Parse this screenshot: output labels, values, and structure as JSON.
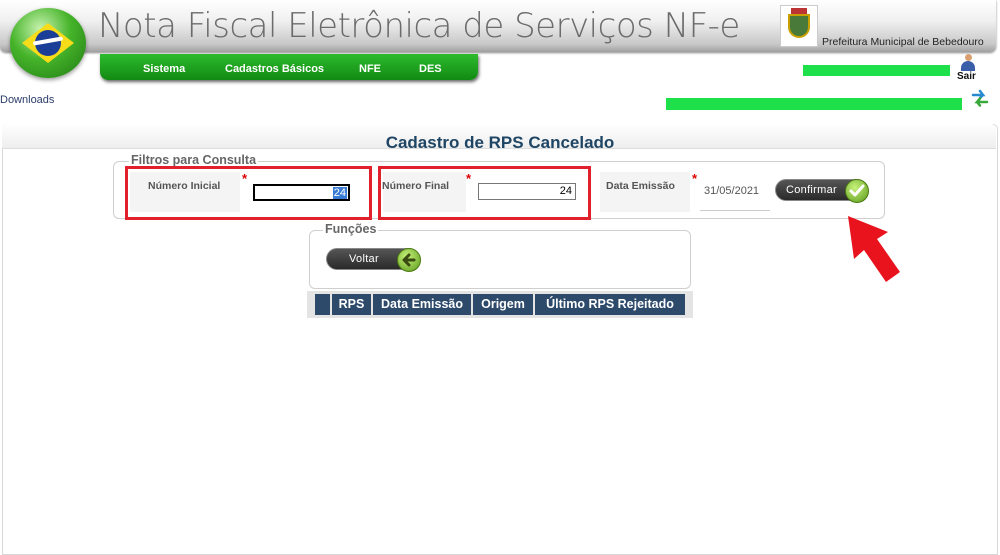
{
  "header": {
    "app_title": "Nota Fiscal Eletrônica de Serviços NF-e",
    "municipality": "Prefeitura Municipal de Bebedouro"
  },
  "menu": {
    "items": [
      {
        "label": "Sistema"
      },
      {
        "label": "Cadastros Básicos"
      },
      {
        "label": "NFE"
      },
      {
        "label": "DES"
      }
    ]
  },
  "user": {
    "logout_label": "Sair"
  },
  "links": {
    "downloads": "Downloads"
  },
  "page": {
    "title": "Cadastro de RPS Cancelado"
  },
  "filters": {
    "legend": "Filtros para Consulta",
    "required_mark": "*",
    "numero_inicial_label": "Número Inicial",
    "numero_inicial_value": "24",
    "numero_final_label": "Número Final",
    "numero_final_value": "24",
    "data_emissao_label": "Data Emissão",
    "data_emissao_value": "31/05/2021",
    "confirm_label": "Confirmar"
  },
  "functions": {
    "legend": "Funções",
    "back_label": "Voltar"
  },
  "table": {
    "columns": [
      "",
      "RPS",
      "Data Emissão",
      "Origem",
      "Último RPS Rejeitado"
    ]
  },
  "colors": {
    "menu_green": "#1aa01a",
    "title_blue": "#1f4564",
    "table_header": "#2d4a6b",
    "highlight_red": "#e0202a",
    "redaction_green": "#1ee04a"
  }
}
